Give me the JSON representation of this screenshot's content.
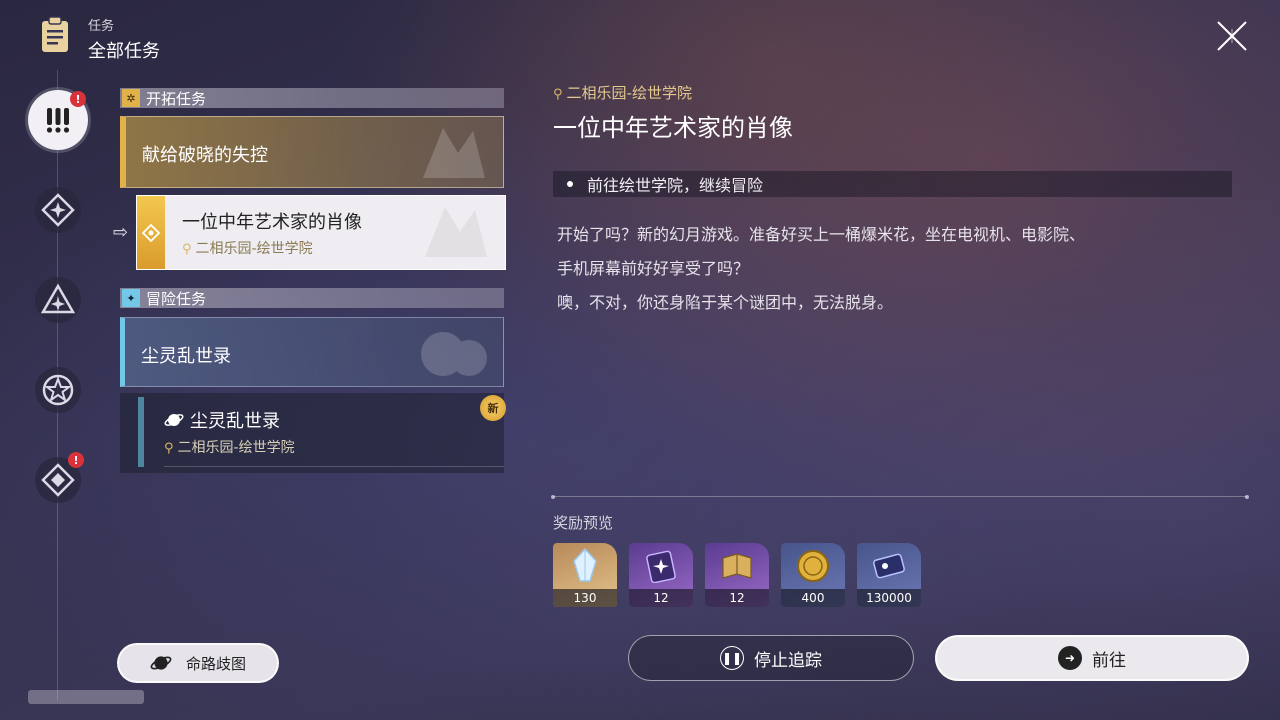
{
  "header": {
    "category": "任务",
    "title": "全部任务"
  },
  "sections": {
    "trailblaze": {
      "label": "开拓任务"
    },
    "adventure": {
      "label": "冒险任务"
    }
  },
  "quests": {
    "q1": {
      "title": "献给破晓的失控"
    },
    "q2": {
      "title": "一位中年艺术家的肖像",
      "location": "二相乐园-绘世学院"
    },
    "q3": {
      "title": "尘灵乱世录"
    },
    "q4": {
      "title": "尘灵乱世录",
      "location": "二相乐园-绘世学院",
      "badge": "新"
    }
  },
  "detail": {
    "location": "二相乐园-绘世学院",
    "title": "一位中年艺术家的肖像",
    "objective": "前往绘世学院，继续冒险",
    "body": [
      "开始了吗？新的幻月游戏。准备好买上一桶爆米花，坐在电视机、电影院、",
      "手机屏幕前好好享受了吗？",
      "噢，不对，你还身陷于某个谜团中，无法脱身。"
    ]
  },
  "rewards": {
    "label": "奖励预览",
    "items": [
      {
        "icon": "crystal-icon",
        "count": "130"
      },
      {
        "icon": "pass-ticket-icon",
        "count": "12"
      },
      {
        "icon": "book-icon",
        "count": "12"
      },
      {
        "icon": "coin-icon",
        "count": "400"
      },
      {
        "icon": "credit-card-icon",
        "count": "130000"
      }
    ]
  },
  "buttons": {
    "stop": "停止追踪",
    "go": "前往",
    "path": "命路歧图"
  },
  "colors": {
    "gold": "#e2b24a",
    "cyan": "#72c8e6",
    "alert": "#d9323a"
  }
}
